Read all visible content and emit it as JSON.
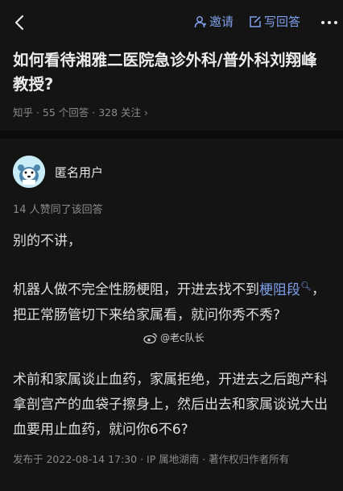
{
  "header": {
    "invite_label": "邀请",
    "write_answer_label": "写回答"
  },
  "question": {
    "title": "如何看待湘雅二医院急诊外科/普外科刘翔峰教授?",
    "meta": "知乎 · 55 个回答 · 328 关注 ›"
  },
  "answer": {
    "author": "匿名用户",
    "likes": "14 人赞同了该回答",
    "p1": "别的不讲，",
    "p2_before": "机器人做不完全性肠梗阻，开进去找不到",
    "p2_link": "梗阻段",
    "p2_after": "，把正常肠管切下来给家属看，就问你秀不秀?",
    "p3": "术前和家属谈止血药，家属拒绝，开进去之后跑产科拿剖宫产的血袋子擦身上，然后出去和家属谈说大出血要用止血药，就问你6不6?",
    "footer": "发布于 2022-08-14 17:30 · IP 属地湖南 · 著作权归作者所有"
  },
  "watermark": {
    "text": "@老c队长"
  },
  "colors": {
    "background": "#141414",
    "accent": "#7f9fea",
    "muted": "#8a8a8a"
  },
  "icons": [
    "back-icon",
    "person-icon",
    "edit-icon",
    "more-icon",
    "search-icon",
    "weibo-icon"
  ]
}
